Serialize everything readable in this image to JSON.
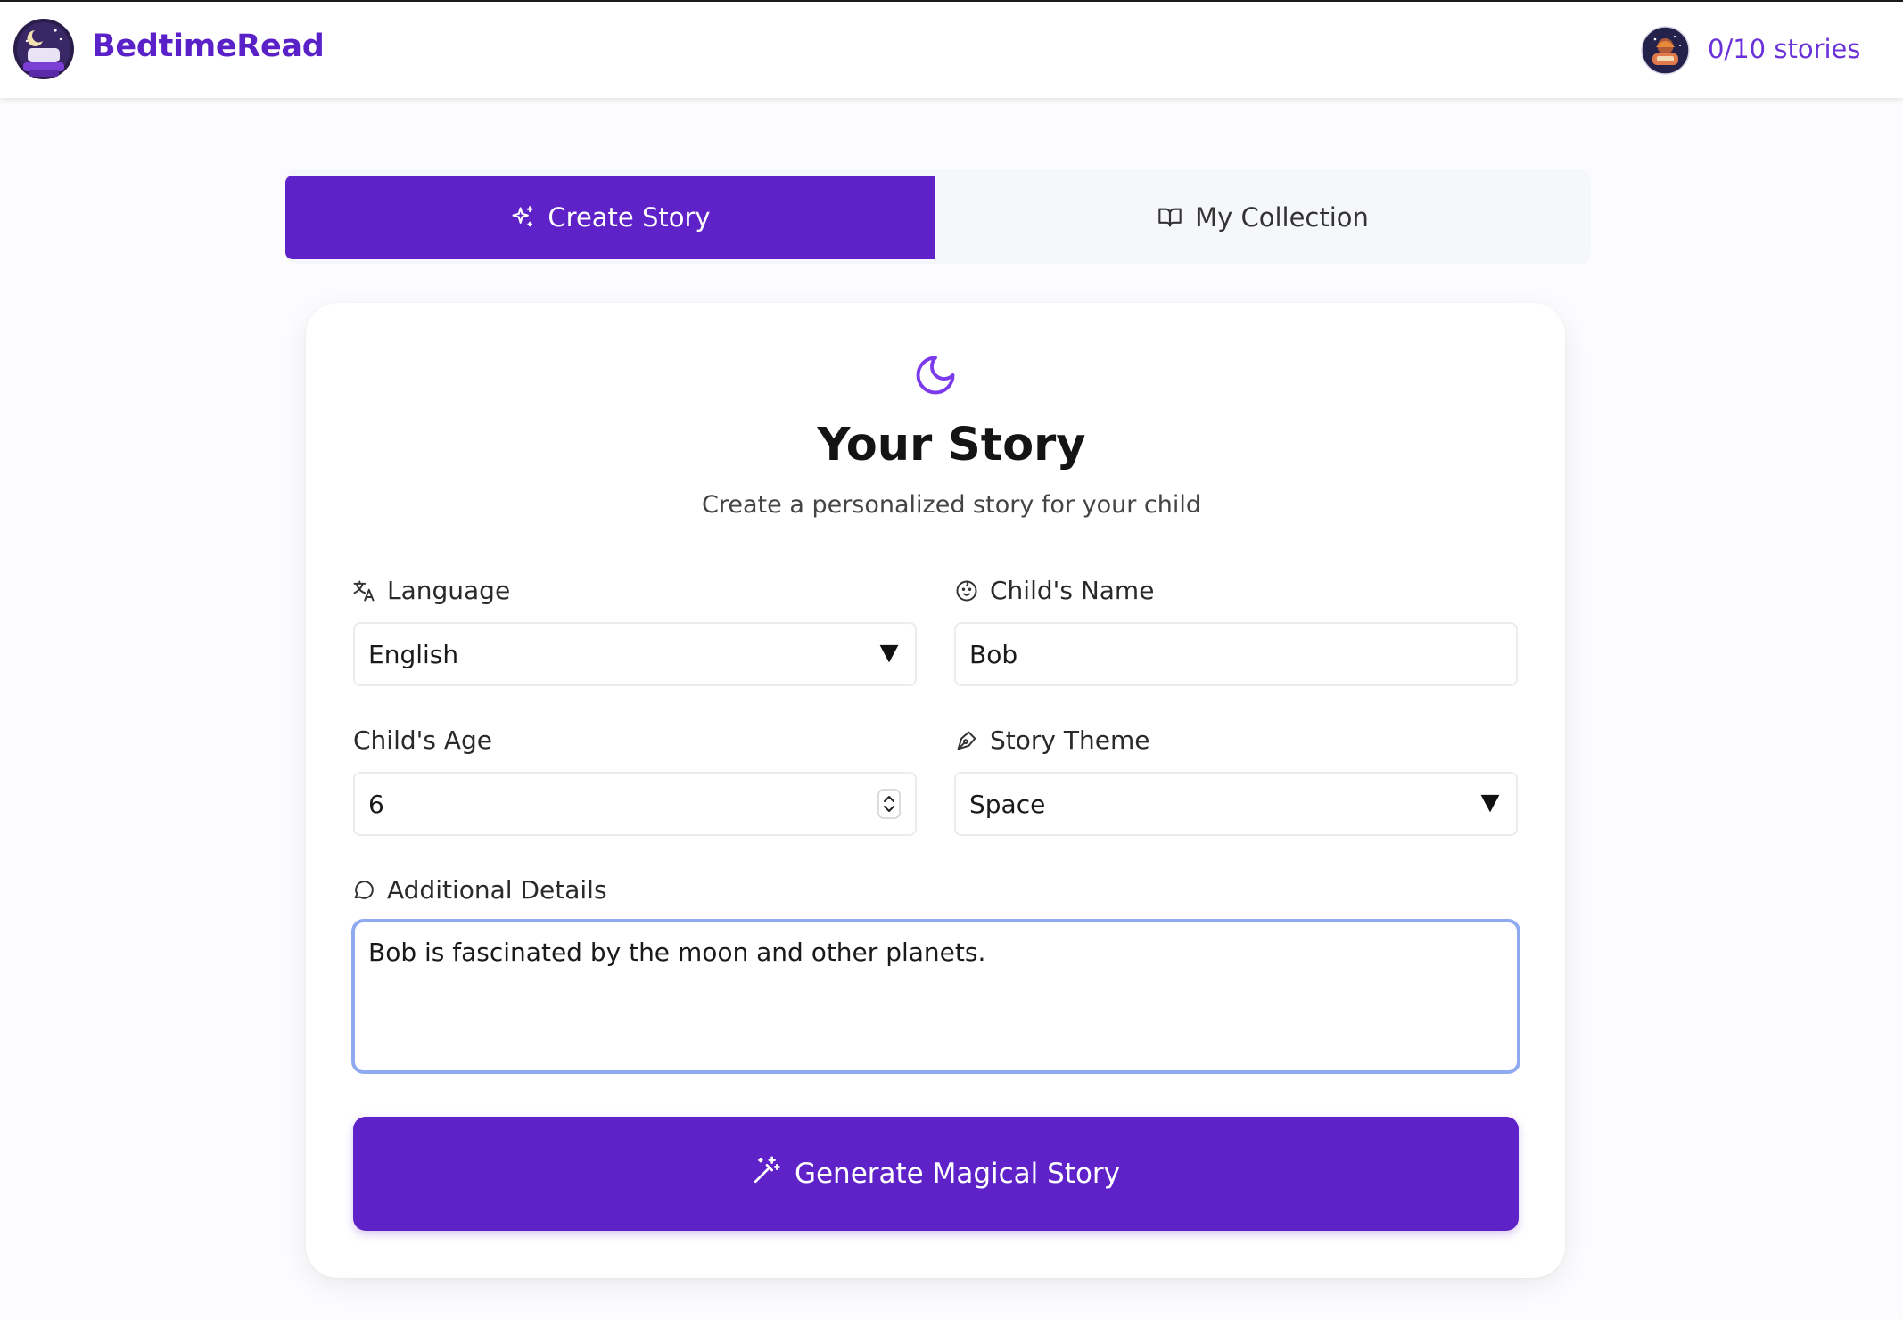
{
  "app": {
    "brand": "BedtimeRead",
    "quota": "0/10 stories",
    "logo_icon": "moon-pillow-logo",
    "avatar_icon": "user-avatar-space"
  },
  "colors": {
    "primary": "#5f22c8",
    "brand_text": "#5b21c8",
    "focus_ring": "#8faaf0"
  },
  "tabs": {
    "create": {
      "label": "Create Story",
      "icon": "sparkles-icon",
      "active": true
    },
    "collection": {
      "label": "My Collection",
      "icon": "book-open-icon",
      "active": false
    }
  },
  "form": {
    "header_icon": "moon-icon",
    "title": "Your Story",
    "subtitle": "Create a personalized story for your child",
    "language": {
      "label": "Language",
      "icon": "translate-icon",
      "value": "English"
    },
    "child_name": {
      "label": "Child's Name",
      "icon": "baby-face-icon",
      "value": "Bob"
    },
    "child_age": {
      "label": "Child's Age",
      "value": "6"
    },
    "story_theme": {
      "label": "Story Theme",
      "icon": "pen-tool-icon",
      "value": "Space"
    },
    "details": {
      "label": "Additional Details",
      "icon": "speech-bubble-icon",
      "value": "Bob is fascinated by the moon and other planets."
    },
    "submit": {
      "label": "Generate Magical Story",
      "icon": "magic-wand-icon"
    }
  }
}
